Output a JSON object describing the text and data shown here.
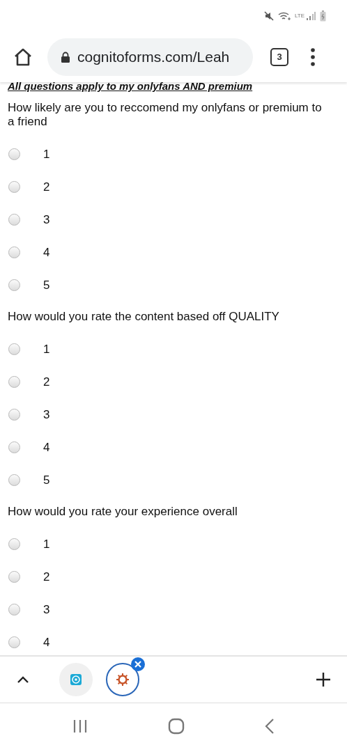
{
  "status_bar": {
    "network": "LTE"
  },
  "browser": {
    "url": "cognitoforms.com/Leah",
    "tab_count": "3"
  },
  "form": {
    "intro": "All questions apply to my onlyfans AND premium",
    "questions": [
      {
        "text": "How likely are you to reccomend my onlyfans or premium to a friend",
        "options": [
          {
            "label": "1",
            "selected": false
          },
          {
            "label": "2",
            "selected": false
          },
          {
            "label": "3",
            "selected": false
          },
          {
            "label": "4",
            "selected": false
          },
          {
            "label": "5",
            "selected": false
          }
        ]
      },
      {
        "text": "How would you rate the content based off QUALITY",
        "options": [
          {
            "label": "1",
            "selected": false
          },
          {
            "label": "2",
            "selected": false
          },
          {
            "label": "3",
            "selected": false
          },
          {
            "label": "4",
            "selected": false
          },
          {
            "label": "5",
            "selected": false
          }
        ]
      },
      {
        "text": "How would you rate your experience overall",
        "options": [
          {
            "label": "1",
            "selected": false
          },
          {
            "label": "2",
            "selected": false
          },
          {
            "label": "3",
            "selected": false
          },
          {
            "label": "4",
            "selected": false
          }
        ]
      }
    ]
  },
  "tab_strip": {
    "tabs": [
      {
        "kind": "vault",
        "selected": false
      },
      {
        "kind": "gear",
        "selected": true
      }
    ]
  }
}
